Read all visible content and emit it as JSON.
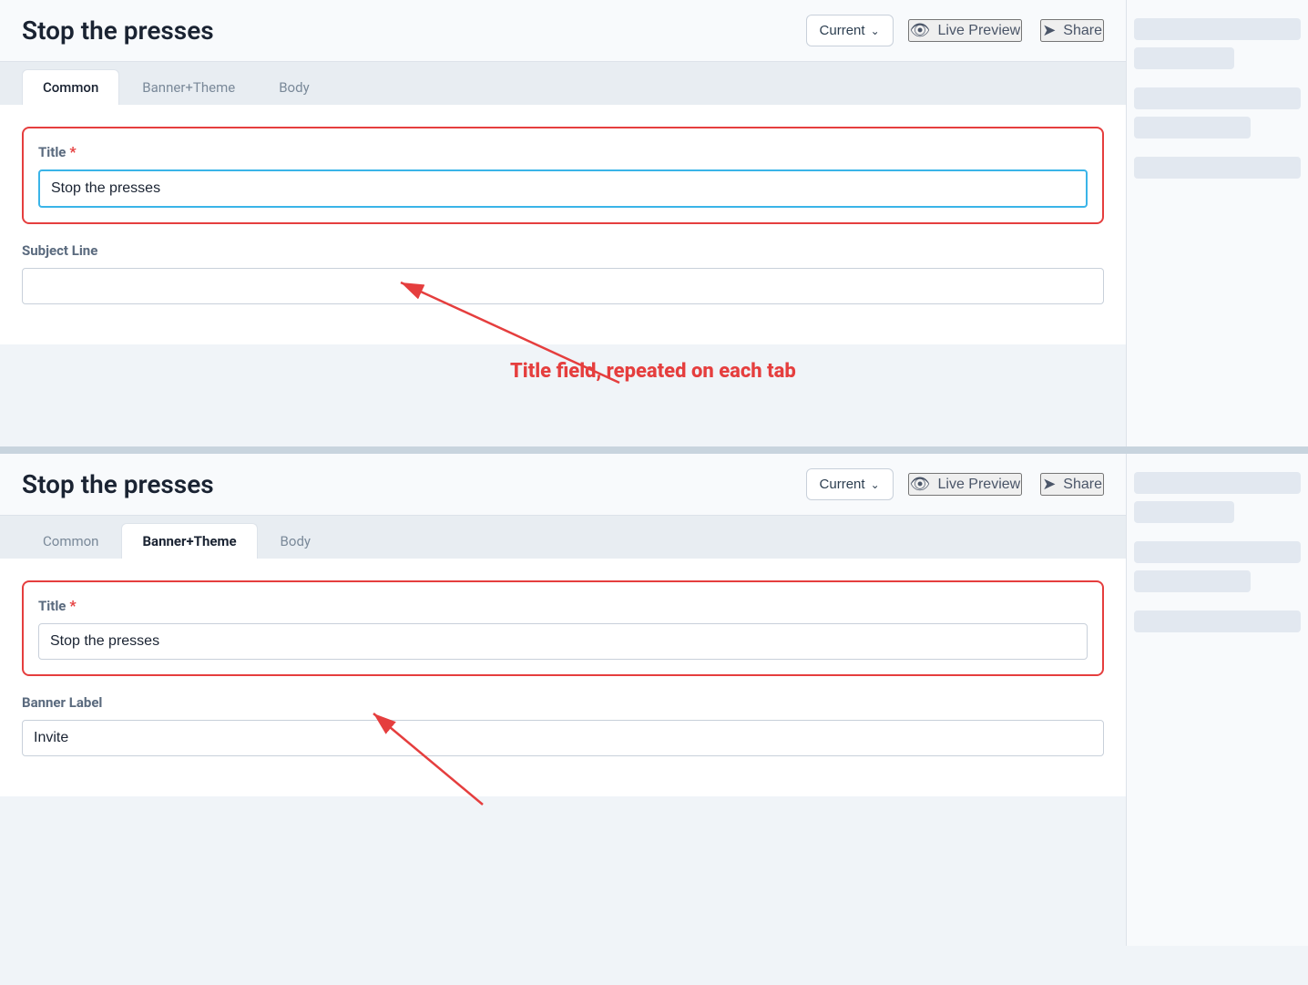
{
  "app": {
    "title": "Stop the presses"
  },
  "panel1": {
    "header": {
      "title": "Stop the presses",
      "dropdown_label": "Current",
      "dropdown_icon": "chevron-down",
      "live_preview_label": "Live Preview",
      "share_label": "Share"
    },
    "tabs": [
      {
        "id": "common",
        "label": "Common",
        "active": true
      },
      {
        "id": "banner-theme",
        "label": "Banner+Theme",
        "active": false
      },
      {
        "id": "body",
        "label": "Body",
        "active": false
      }
    ],
    "form": {
      "title_label": "Title",
      "title_required": true,
      "title_value": "Stop the presses",
      "subject_line_label": "Subject Line",
      "subject_line_value": ""
    }
  },
  "panel2": {
    "header": {
      "title": "Stop the presses",
      "dropdown_label": "Current",
      "dropdown_icon": "chevron-down",
      "live_preview_label": "Live Preview",
      "share_label": "Share"
    },
    "tabs": [
      {
        "id": "common",
        "label": "Common",
        "active": false
      },
      {
        "id": "banner-theme",
        "label": "Banner+Theme",
        "active": true
      },
      {
        "id": "body",
        "label": "Body",
        "active": false
      }
    ],
    "form": {
      "title_label": "Title",
      "title_required": true,
      "title_value": "Stop the presses",
      "banner_label_label": "Banner Label",
      "banner_label_value": "Invite"
    }
  },
  "annotation": {
    "text": "Title field, repeated on each tab",
    "required_star": "*"
  },
  "sidebar_items": [
    "s1",
    "s2",
    "s3",
    "s4",
    "s5",
    "s6",
    "s7",
    "s8"
  ],
  "icons": {
    "eye": "◉",
    "share": "➦",
    "chevron_down": "∨"
  }
}
